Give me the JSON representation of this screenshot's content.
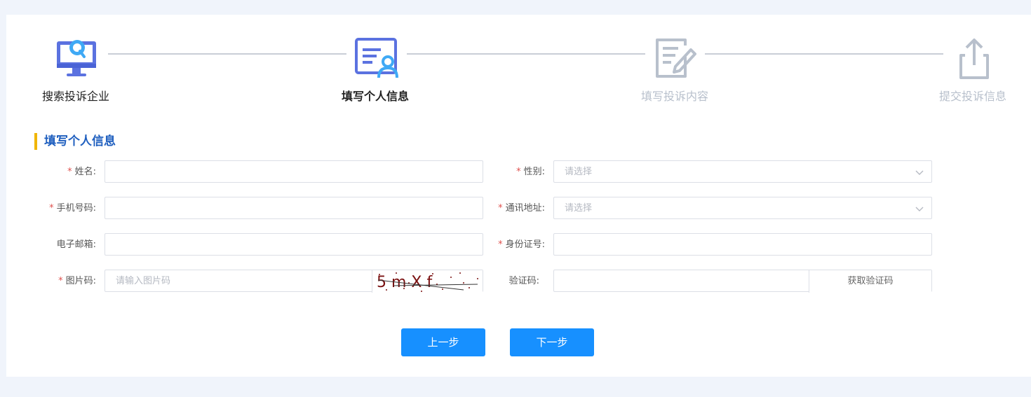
{
  "steps": [
    {
      "label": "搜索投诉企业",
      "state": "done",
      "icon": "search-monitor-icon"
    },
    {
      "label": "填写个人信息",
      "state": "current",
      "icon": "personal-info-card-icon"
    },
    {
      "label": "填写投诉内容",
      "state": "pending",
      "icon": "edit-document-icon"
    },
    {
      "label": "提交投诉信息",
      "state": "pending",
      "icon": "upload-icon"
    }
  ],
  "section_title": "填写个人信息",
  "required_mark": "*",
  "form": {
    "name": {
      "label": "姓名:",
      "value": ""
    },
    "gender": {
      "label": "性别:",
      "placeholder": "请选择"
    },
    "phone": {
      "label": "手机号码:",
      "value": ""
    },
    "address": {
      "label": "通讯地址:",
      "placeholder": "请选择"
    },
    "email": {
      "label": "电子邮箱:",
      "value": ""
    },
    "id_number": {
      "label": "身份证号:",
      "value": ""
    },
    "image_code": {
      "label": "图片码:",
      "placeholder": "请输入图片码",
      "captcha_text": "5 m X f"
    },
    "sms_code": {
      "label": "验证码:",
      "value": "",
      "button": "获取验证码"
    }
  },
  "buttons": {
    "prev": "上一步",
    "next": "下一步"
  },
  "colors": {
    "accent": "#1790ff",
    "section_title": "#1f5fbf",
    "section_bar": "#f0b500",
    "required": "#e0524f",
    "step_icon_active": "#5b72e0",
    "step_icon_pending": "#b8c0cc"
  }
}
